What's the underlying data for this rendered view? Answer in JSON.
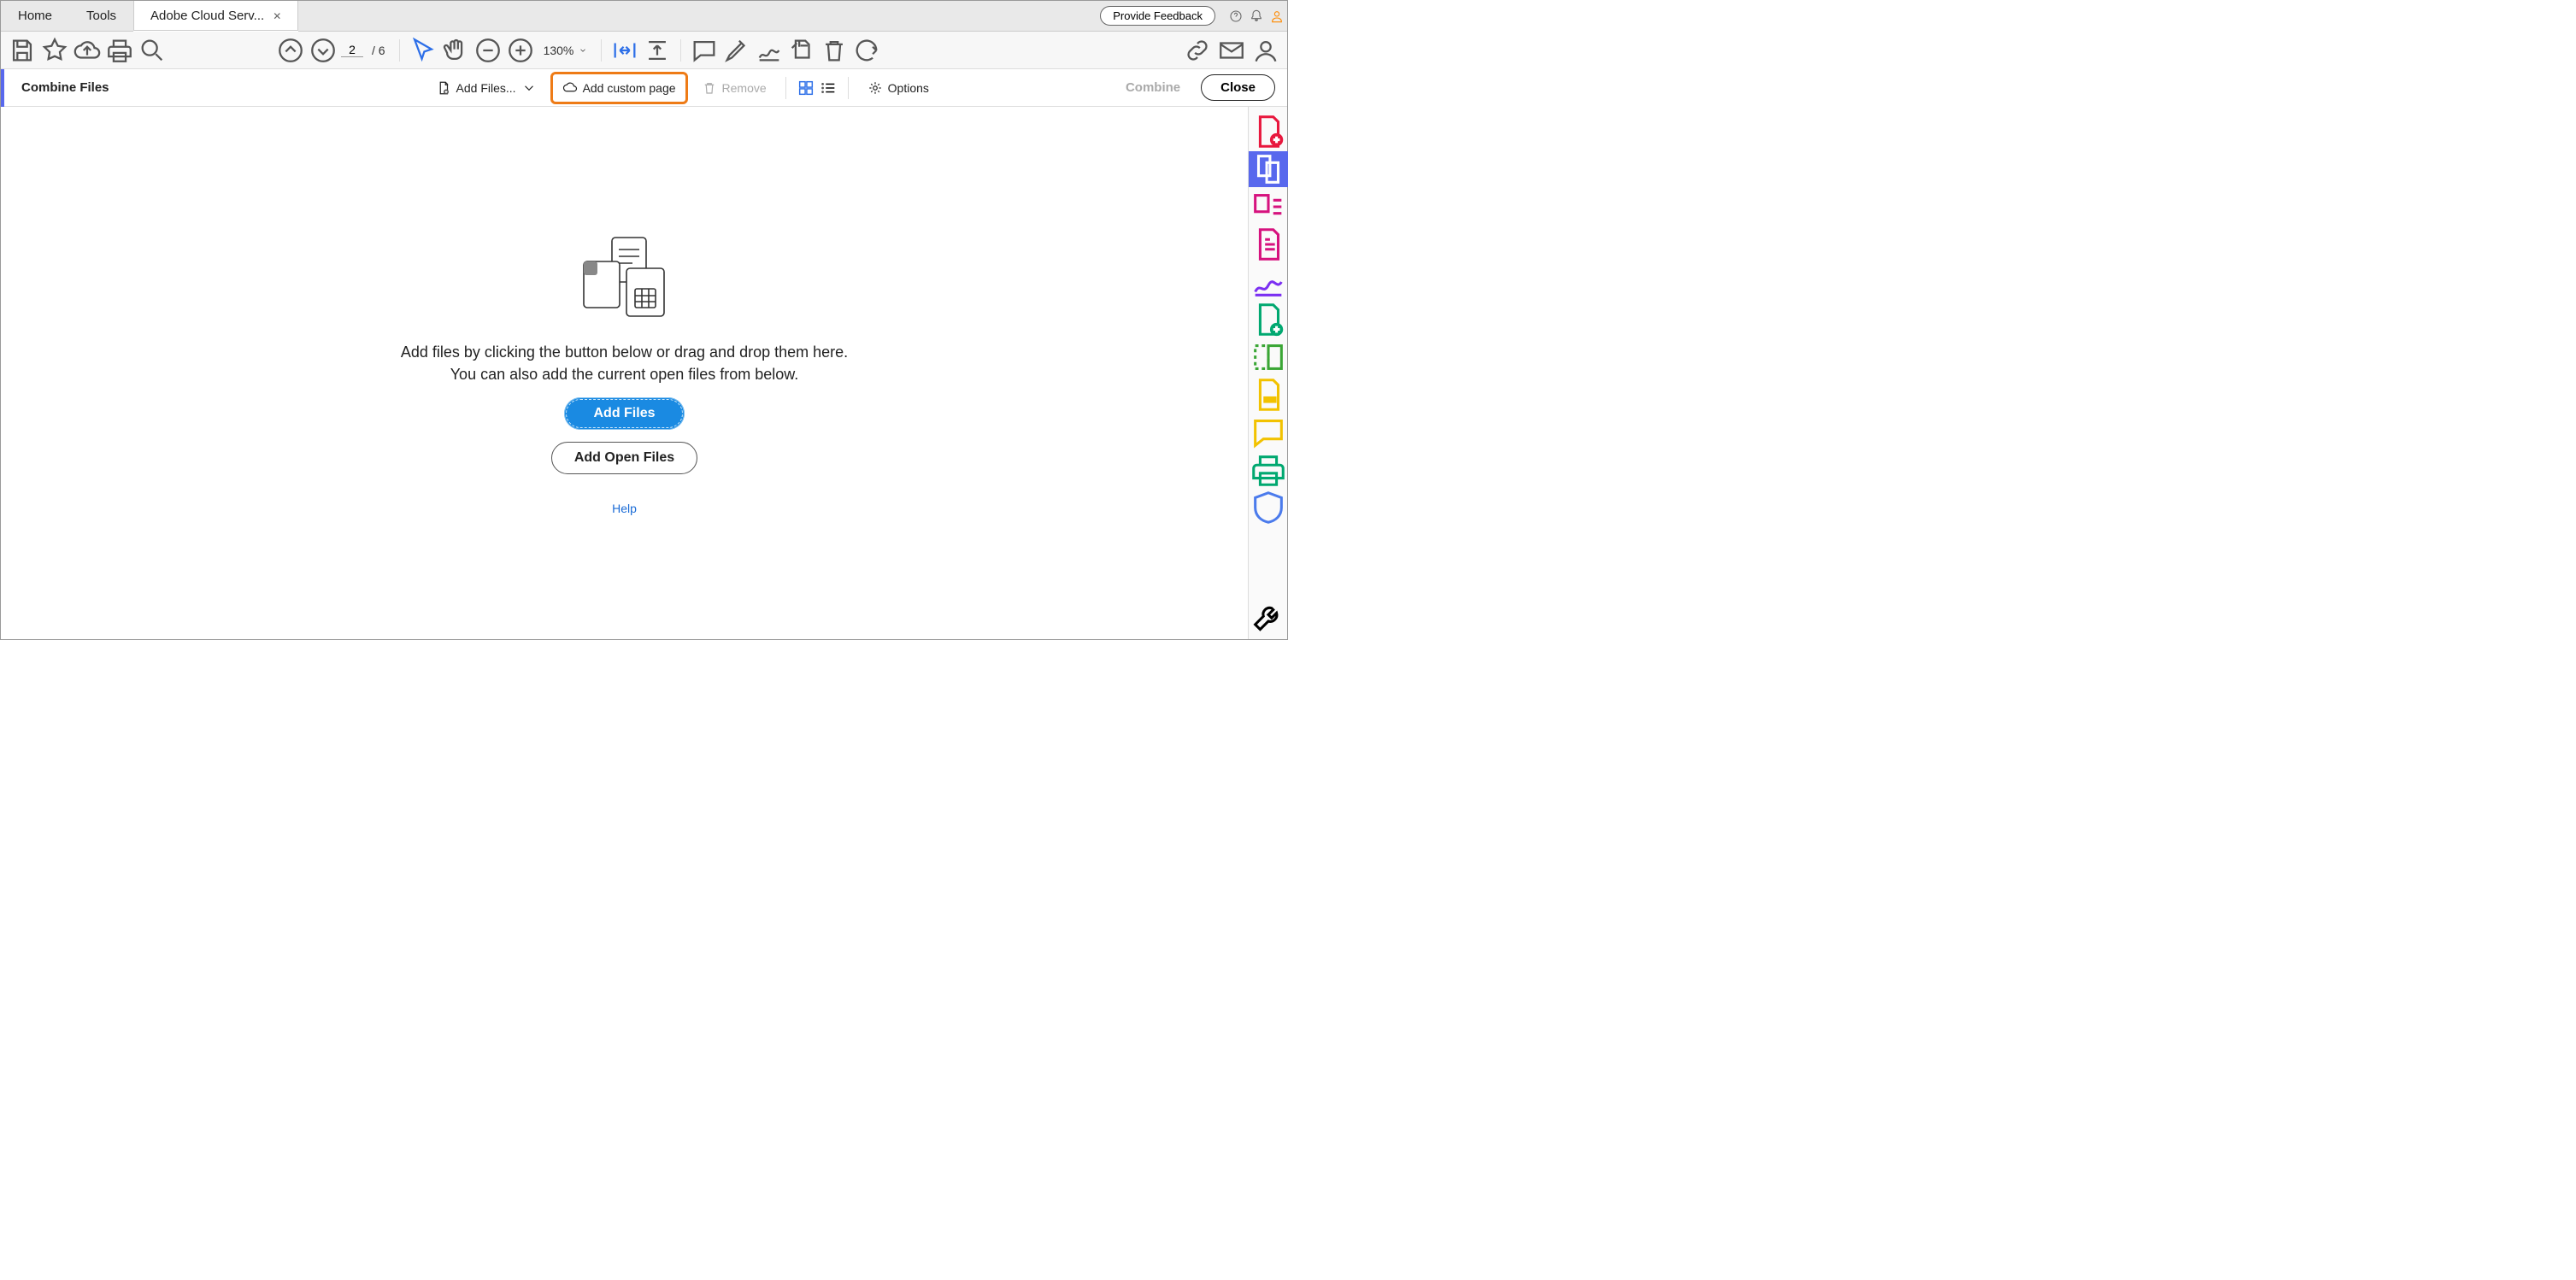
{
  "tabs": {
    "home": "Home",
    "tools": "Tools",
    "doc": "Adobe Cloud Serv..."
  },
  "header": {
    "feedback": "Provide Feedback"
  },
  "maintoolbar": {
    "page_current": "2",
    "page_total": "/ 6",
    "zoom": "130%"
  },
  "subtoolbar": {
    "title": "Combine Files",
    "add_files": "Add Files...",
    "add_custom": "Add custom page",
    "remove": "Remove",
    "options": "Options",
    "combine": "Combine",
    "close": "Close"
  },
  "canvas": {
    "line1": "Add files by clicking the button below or drag and drop them here.",
    "line2": "You can also add the current open files from below.",
    "add_files_btn": "Add Files",
    "add_open_btn": "Add Open Files",
    "help": "Help"
  }
}
